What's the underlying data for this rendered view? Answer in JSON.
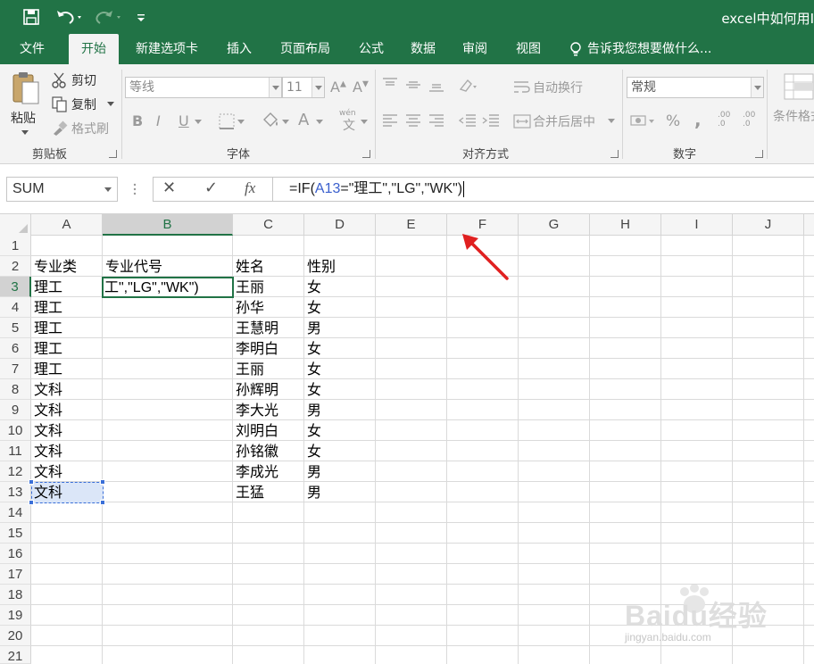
{
  "window": {
    "title": "excel中如何用I"
  },
  "ribbon_tabs": [
    "文件",
    "开始",
    "新建选项卡",
    "插入",
    "页面布局",
    "公式",
    "数据",
    "审阅",
    "视图",
    "告诉我您想要做什么..."
  ],
  "active_tab": "开始",
  "clipboard": {
    "paste": "粘贴",
    "cut": "剪切",
    "copy": "复制",
    "format_painter": "格式刷",
    "group_label": "剪贴板"
  },
  "font": {
    "font_name_placeholder": "等线",
    "font_size": "11",
    "bold": "B",
    "italic": "I",
    "underline": "U",
    "font_color_letter": "A",
    "phonetic": "wén",
    "group_label": "字体"
  },
  "alignment": {
    "wrap_text": "自动换行",
    "merge_center": "合并后居中",
    "group_label": "对齐方式"
  },
  "number": {
    "format": "常规",
    "percent": "%",
    "comma": ",",
    "inc_decimal": ".00 .0",
    "dec_decimal": ".00 .0",
    "group_label": "数字"
  },
  "styles": {
    "conditional": "条件格式"
  },
  "formula_bar": {
    "name_box": "SUM",
    "cancel": "✕",
    "enter": "✓",
    "fx": "fx",
    "formula_prefix": "=IF(",
    "formula_ref": "A13",
    "formula_suffix": "=\"理工\",\"LG\",\"WK\")"
  },
  "columns": [
    "A",
    "B",
    "C",
    "D",
    "E",
    "F",
    "G",
    "H",
    "I",
    "J"
  ],
  "rows": [
    "1",
    "2",
    "3",
    "4",
    "5",
    "6",
    "7",
    "8",
    "9",
    "10",
    "11",
    "12",
    "13",
    "14",
    "15",
    "16",
    "17",
    "18",
    "19",
    "20",
    "21"
  ],
  "cells": {
    "A2": "专业类",
    "B2": "专业代号",
    "C2": "姓名",
    "D2": "性别",
    "A3": "理工",
    "B3": "工\",\"LG\",\"WK\")",
    "C3": "王丽",
    "D3": "女",
    "A4": "理工",
    "C4": "孙华",
    "D4": "女",
    "A5": "理工",
    "C5": "王慧明",
    "D5": "男",
    "A6": "理工",
    "C6": "李明白",
    "D6": "女",
    "A7": "理工",
    "C7": "王丽",
    "D7": "女",
    "A8": "文科",
    "C8": "孙辉明",
    "D8": "女",
    "A9": "文科",
    "C9": "李大光",
    "D9": "男",
    "A10": "文科",
    "C10": "刘明白",
    "D10": "女",
    "A11": "文科",
    "C11": "孙铭徽",
    "D11": "女",
    "A12": "文科",
    "C12": "李成光",
    "D12": "男",
    "A13": "文科",
    "C13": "王猛",
    "D13": "男"
  },
  "watermark": {
    "brand": "Baidu经验",
    "url": "jingyan.baidu.com"
  },
  "colors": {
    "excel_green": "#217346",
    "ref_blue": "#3a5fcd",
    "arrow_red": "#e02020"
  }
}
